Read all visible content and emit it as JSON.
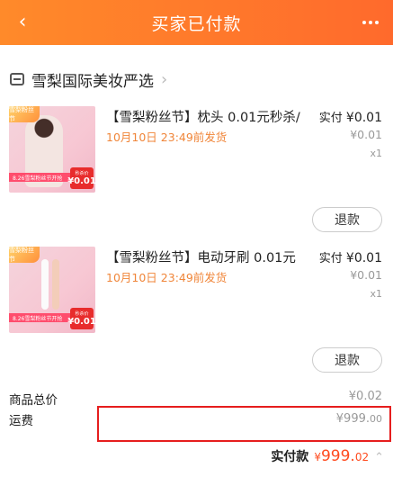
{
  "header": {
    "title": "买家已付款"
  },
  "store": {
    "name": "雪梨国际美妆严选"
  },
  "items": [
    {
      "name": "【雪梨粉丝节】枕头 0.01元秒杀/",
      "delivery": "10月10日 23:49前发货",
      "paid_label": "实付",
      "paid_amount": "¥0.01",
      "orig_price": "¥0.01",
      "qty": "x1",
      "refund_label": "退款",
      "thumb_badge": "雪梨粉丝节",
      "thumb_strip": "8.26雪梨粉丝节开抢",
      "thumb_price_label": "秒杀价",
      "thumb_price": "¥0.01"
    },
    {
      "name": "【雪梨粉丝节】电动牙刷 0.01元",
      "delivery": "10月10日 23:49前发货",
      "paid_label": "实付",
      "paid_amount": "¥0.01",
      "orig_price": "¥0.01",
      "qty": "x1",
      "refund_label": "退款",
      "thumb_badge": "雪梨粉丝节",
      "thumb_strip": "8.26雪梨粉丝节开抢",
      "thumb_price_label": "秒杀价",
      "thumb_price": "¥0.01"
    }
  ],
  "summary": {
    "total_label": "商品总价",
    "total_value": "¥0.02",
    "shipping_label": "运费",
    "shipping_main": "¥999.",
    "shipping_dec": "00",
    "actual_label": "实付款",
    "actual_yen": "¥",
    "actual_main": "999.",
    "actual_dec": "02"
  },
  "colors": {
    "accent": "#ff6a2c",
    "price": "#ff4b1f",
    "highlight": "#e61e1e"
  }
}
